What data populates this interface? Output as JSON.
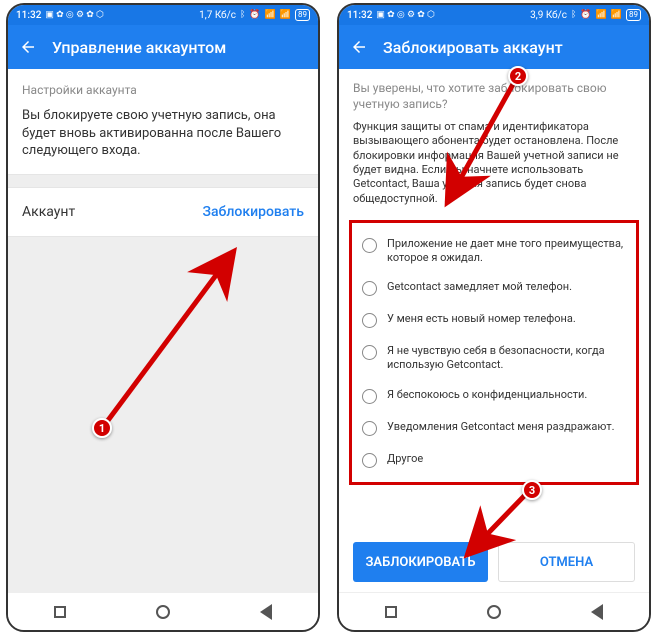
{
  "status": {
    "time": "11:32",
    "data_rate_left": "1,7 Кб/с",
    "data_rate_right": "3,9 Кб/с",
    "battery": "89"
  },
  "left": {
    "title": "Управление аккаунтом",
    "section_label": "Настройки аккаунта",
    "section_text": "Вы блокируете свою учетную запись, она будет вновь активированна после Вашего следующего входа.",
    "account_label": "Аккаунт",
    "block_action": "Заблокировать"
  },
  "right": {
    "title": "Заблокировать аккаунт",
    "confirm_q": "Вы уверены, что хотите заблокировать свою учетную запись?",
    "confirm_text": "Функция защиты от спама и идентификатора вызывающего абонента будет остановлена. После блокировки информация Вашей учетной записи не будет видна. Если Вы начнете использовать Getcontact, Ваша учетная запись будет снова общедоступной.",
    "reasons": [
      "Приложение не дает мне того преимущества, которое я ожидал.",
      "Getcontact замедляет мой телефон.",
      "У меня есть новый номер телефона.",
      "Я не чувствую себя в безопасности, когда использую Getcontact.",
      "Я беспокоюсь о конфиденциальности.",
      "Уведомления Getcontact меня раздражают.",
      "Другое"
    ],
    "btn_primary": "ЗАБЛОКИРОВАТЬ",
    "btn_secondary": "ОТМЕНА"
  },
  "markers": {
    "m1": "1",
    "m2": "2",
    "m3": "3"
  }
}
